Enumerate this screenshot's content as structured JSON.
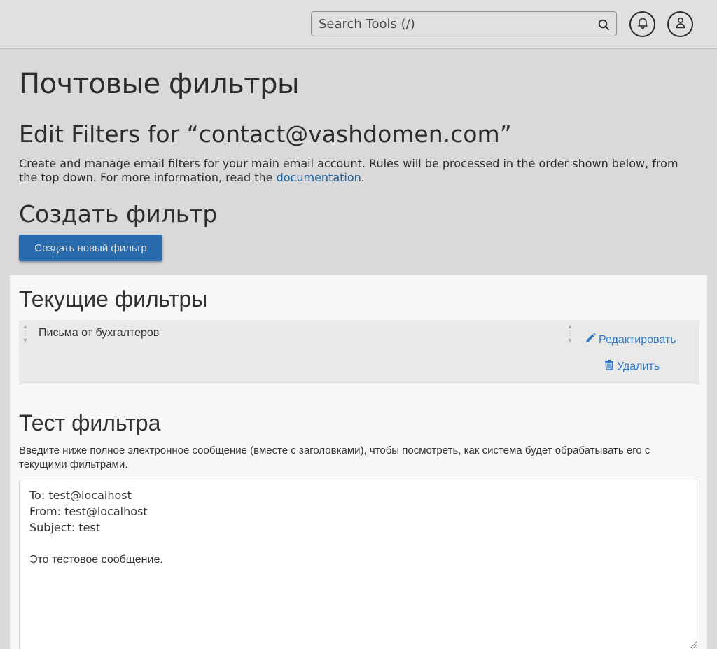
{
  "header": {
    "search_placeholder": "Search Tools (/)"
  },
  "page": {
    "title": "Почтовые фильтры",
    "edit_heading": "Edit Filters for “contact@vashdomen.com”",
    "description_prefix": "Create and manage email filters for your main email account. Rules will be processed in the order shown below, from the top down. For more information, read the ",
    "description_link": "documentation",
    "description_suffix": ".",
    "create_heading": "Создать фильтр",
    "create_button": "Создать новый фильтр"
  },
  "current_filters": {
    "heading": "Текущие фильтры",
    "items": [
      {
        "name": "Письма от бухгалтеров",
        "edit_label": "Редактировать",
        "delete_label": "Удалить"
      }
    ]
  },
  "test_filter": {
    "heading": "Тест фильтра",
    "description": "Введите ниже полное электронное сообщение (вместе с заголовками), чтобы посмотреть, как система будет обрабатывать его с текущими фильтрами.",
    "lines": [
      "To: test@localhost",
      "From: test@localhost",
      "Subject: test",
      "",
      "Это тестовое сообщение."
    ]
  },
  "colors": {
    "accent": "#2e7cc6",
    "link": "#2d77c2",
    "background": "#f7f7f7"
  },
  "icons": [
    "search-icon",
    "bell-icon",
    "user-icon",
    "pencil-icon",
    "trash-icon",
    "drag-handle-icon"
  ]
}
